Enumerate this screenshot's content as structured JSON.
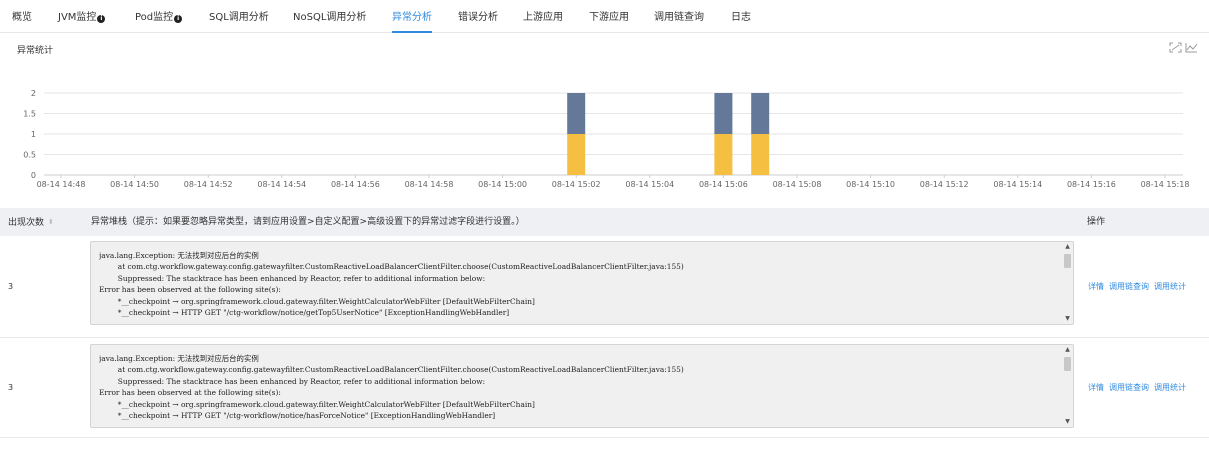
{
  "tabs": [
    {
      "label": "概览",
      "info": false,
      "active": false
    },
    {
      "label": "JVM监控",
      "info": true,
      "active": false
    },
    {
      "label": "Pod监控",
      "info": true,
      "active": false
    },
    {
      "label": "SQL调用分析",
      "info": false,
      "active": false
    },
    {
      "label": "NoSQL调用分析",
      "info": false,
      "active": false
    },
    {
      "label": "异常分析",
      "info": false,
      "active": true
    },
    {
      "label": "错误分析",
      "info": false,
      "active": false
    },
    {
      "label": "上游应用",
      "info": false,
      "active": false
    },
    {
      "label": "下游应用",
      "info": false,
      "active": false
    },
    {
      "label": "调用链查询",
      "info": false,
      "active": false
    },
    {
      "label": "日志",
      "info": false,
      "active": false
    }
  ],
  "chart_section": {
    "title": "异常统计",
    "icons": [
      "expand-icon",
      "line-chart-icon"
    ]
  },
  "chart_data": {
    "type": "bar",
    "stacked": true,
    "title": "",
    "xlabel": "",
    "ylabel": "",
    "ylim": [
      0,
      2
    ],
    "yticks": [
      "0",
      "0.5",
      "1",
      "1.5",
      "2"
    ],
    "x_tick_labels": [
      "08-14 14:48",
      "08-14 14:50",
      "08-14 14:52",
      "08-14 14:54",
      "08-14 14:56",
      "08-14 14:58",
      "08-14 15:00",
      "08-14 15:02",
      "08-14 15:04",
      "08-14 15:06",
      "08-14 15:08",
      "08-14 15:10",
      "08-14 15:12",
      "08-14 15:14",
      "08-14 15:16",
      "08-14 15:18"
    ],
    "categories": [
      "08-14 15:02",
      "08-14 15:06",
      "08-14 15:07"
    ],
    "series": [
      {
        "values": [
          1,
          1,
          1
        ],
        "color": "#f5bf42"
      },
      {
        "values": [
          1,
          1,
          1
        ],
        "color": "#647999"
      }
    ],
    "grid": true,
    "legend": "none"
  },
  "table": {
    "headers": {
      "count": "出现次数",
      "stack": "异常堆栈（提示：如果要忽略异常类型，请到应用设置>自定义配置>高级设置下的异常过滤字段进行设置。）",
      "ops": "操作"
    },
    "rows": [
      {
        "count": "3",
        "lines": [
          "java.lang.Exception: 无法找到对应后台的实例",
          "\tat com.ctg.workflow.gateway.config.gatewayfilter.CustomReactiveLoadBalancerClientFilter.choose(CustomReactiveLoadBalancerClientFilter.java:155)",
          "\tSuppressed: The stacktrace has been enhanced by Reactor, refer to additional information below:",
          "Error has been observed at the following site(s):",
          "\t*__checkpoint → org.springframework.cloud.gateway.filter.WeightCalculatorWebFilter [DefaultWebFilterChain]",
          "\t*__checkpoint → HTTP GET \"/ctg-workflow/notice/getTop5UserNotice\" [ExceptionHandlingWebHandler]"
        ],
        "actions": [
          "详情",
          "调用链查询",
          "调用统计"
        ]
      },
      {
        "count": "3",
        "lines": [
          "java.lang.Exception: 无法找到对应后台的实例",
          "\tat com.ctg.workflow.gateway.config.gatewayfilter.CustomReactiveLoadBalancerClientFilter.choose(CustomReactiveLoadBalancerClientFilter.java:155)",
          "\tSuppressed: The stacktrace has been enhanced by Reactor, refer to additional information below:",
          "Error has been observed at the following site(s):",
          "\t*__checkpoint → org.springframework.cloud.gateway.filter.WeightCalculatorWebFilter [DefaultWebFilterChain]",
          "\t*__checkpoint → HTTP GET \"/ctg-workflow/notice/hasForceNotice\" [ExceptionHandlingWebHandler]"
        ],
        "actions": [
          "详情",
          "调用链查询",
          "调用统计"
        ]
      }
    ]
  }
}
